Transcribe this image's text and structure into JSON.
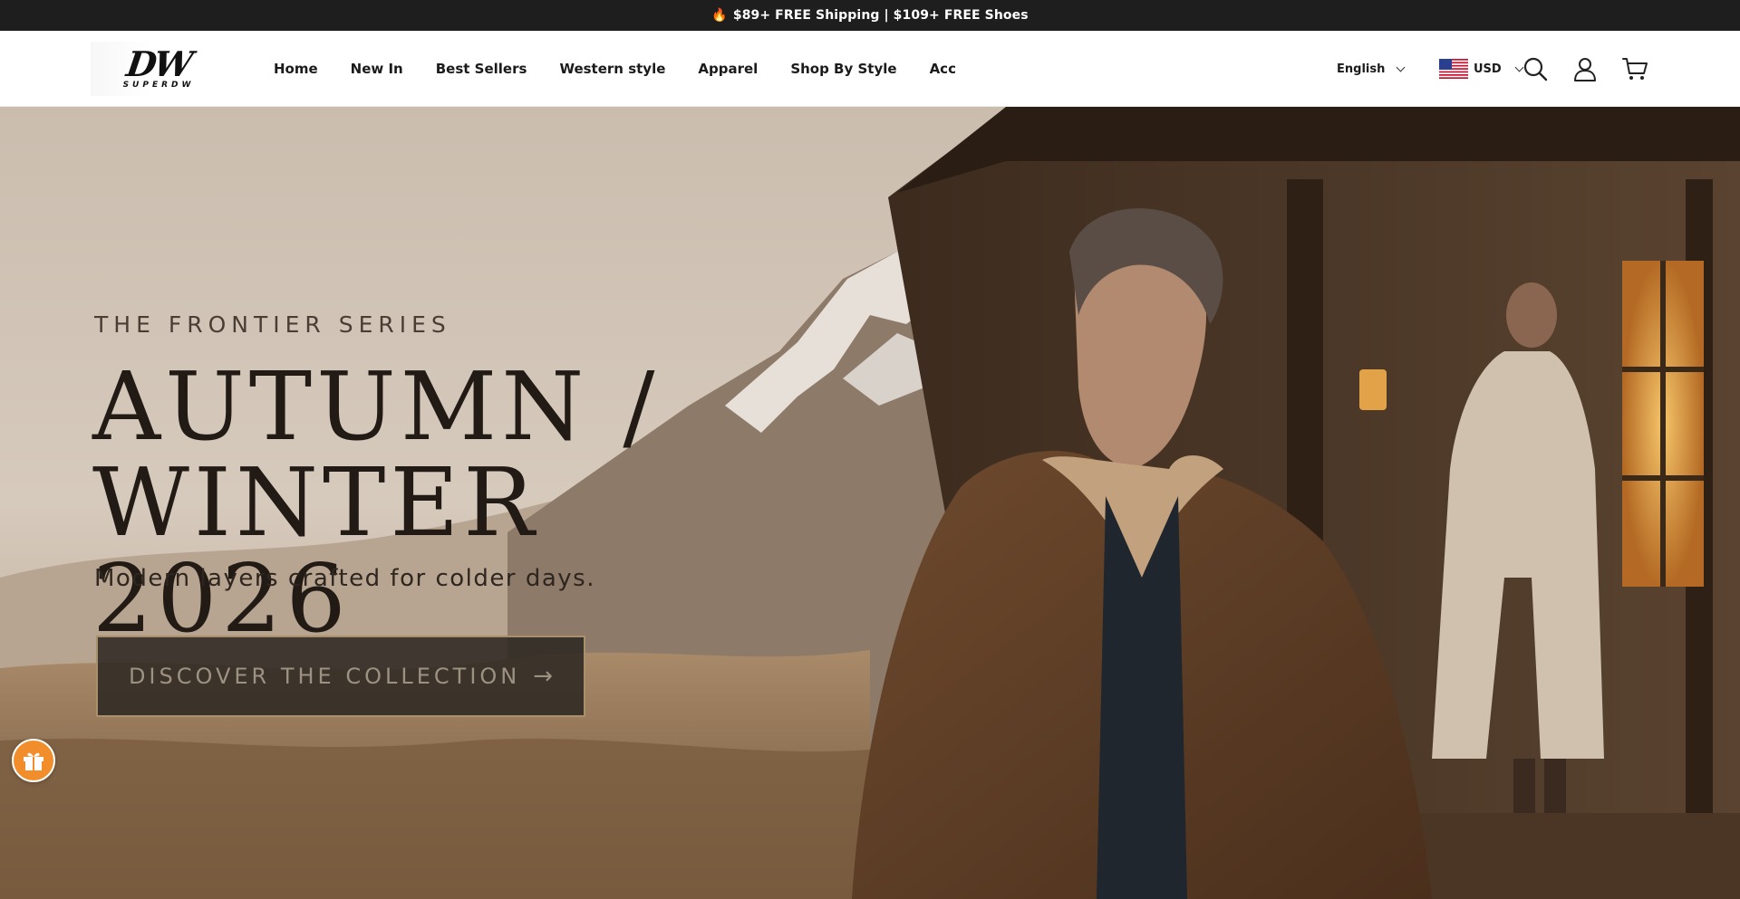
{
  "announcement": {
    "icon": "fire-icon",
    "text": "$89+ FREE Shipping | $109+ FREE Shoes"
  },
  "header": {
    "logo": {
      "mark": "DW",
      "word": "SUPERDW"
    },
    "nav": [
      {
        "label": "Home"
      },
      {
        "label": "New In"
      },
      {
        "label": "Best Sellers"
      },
      {
        "label": "Western style"
      },
      {
        "label": "Apparel"
      },
      {
        "label": "Shop By Style"
      },
      {
        "label": "Acc"
      }
    ],
    "language": "English",
    "currency": {
      "code": "USD",
      "flag": "us-flag-icon"
    },
    "icons": [
      "search-icon",
      "account-icon",
      "cart-icon"
    ]
  },
  "hero": {
    "eyebrow": "THE FRONTIER SERIES",
    "headline_line1": "AUTUMN /",
    "headline_line2": "WINTER 2026",
    "subline": "Modern layers crafted for colder days.",
    "cta": {
      "label": "DISCOVER THE COLLECTION",
      "arrow": "→"
    }
  },
  "floating": {
    "gift_icon": "gift-icon"
  },
  "colors": {
    "announcement_bg": "#1e1e1e",
    "cta_bg": "#2d2822",
    "cta_border": "#a8906d",
    "gift_button": "#f28d2b"
  }
}
